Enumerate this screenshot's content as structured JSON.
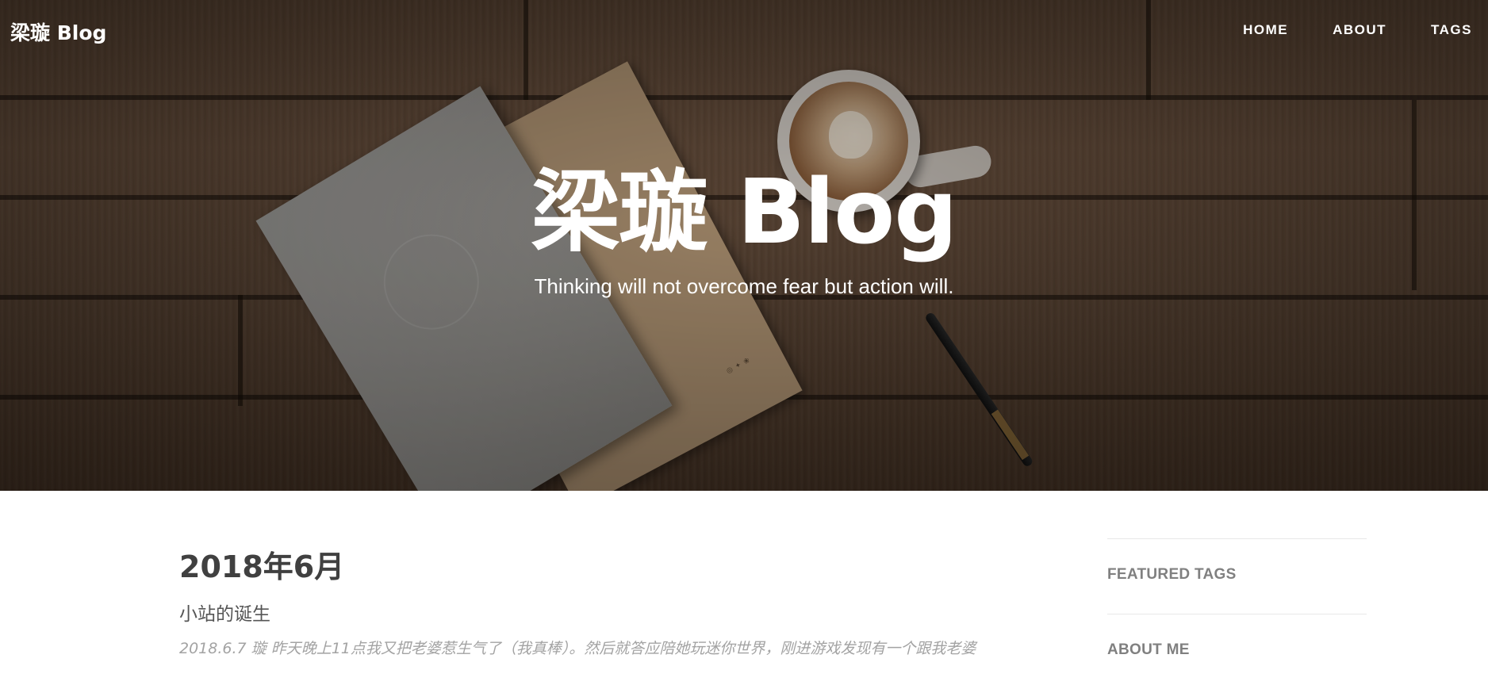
{
  "navbar": {
    "brand": "梁璇 Blog",
    "links": [
      "HOME",
      "ABOUT",
      "TAGS"
    ]
  },
  "hero": {
    "title": "梁璇 Blog",
    "subtitle": "Thinking will not overcome fear but action will."
  },
  "post": {
    "title": "2018年6月",
    "subtitle": "小站的诞生",
    "excerpt": "2018.6.7 璇 昨天晚上11点我又把老婆惹生气了（我真棒）。然后就答应陪她玩迷你世界，刚进游戏发现有一个跟我老婆"
  },
  "sidebar": {
    "featured_tags_heading": "FEATURED TAGS",
    "about_me_heading": "ABOUT ME"
  },
  "colors": {
    "text_dark": "#404040",
    "text_muted": "#a3a3a3",
    "sidebar_heading": "#808080"
  }
}
